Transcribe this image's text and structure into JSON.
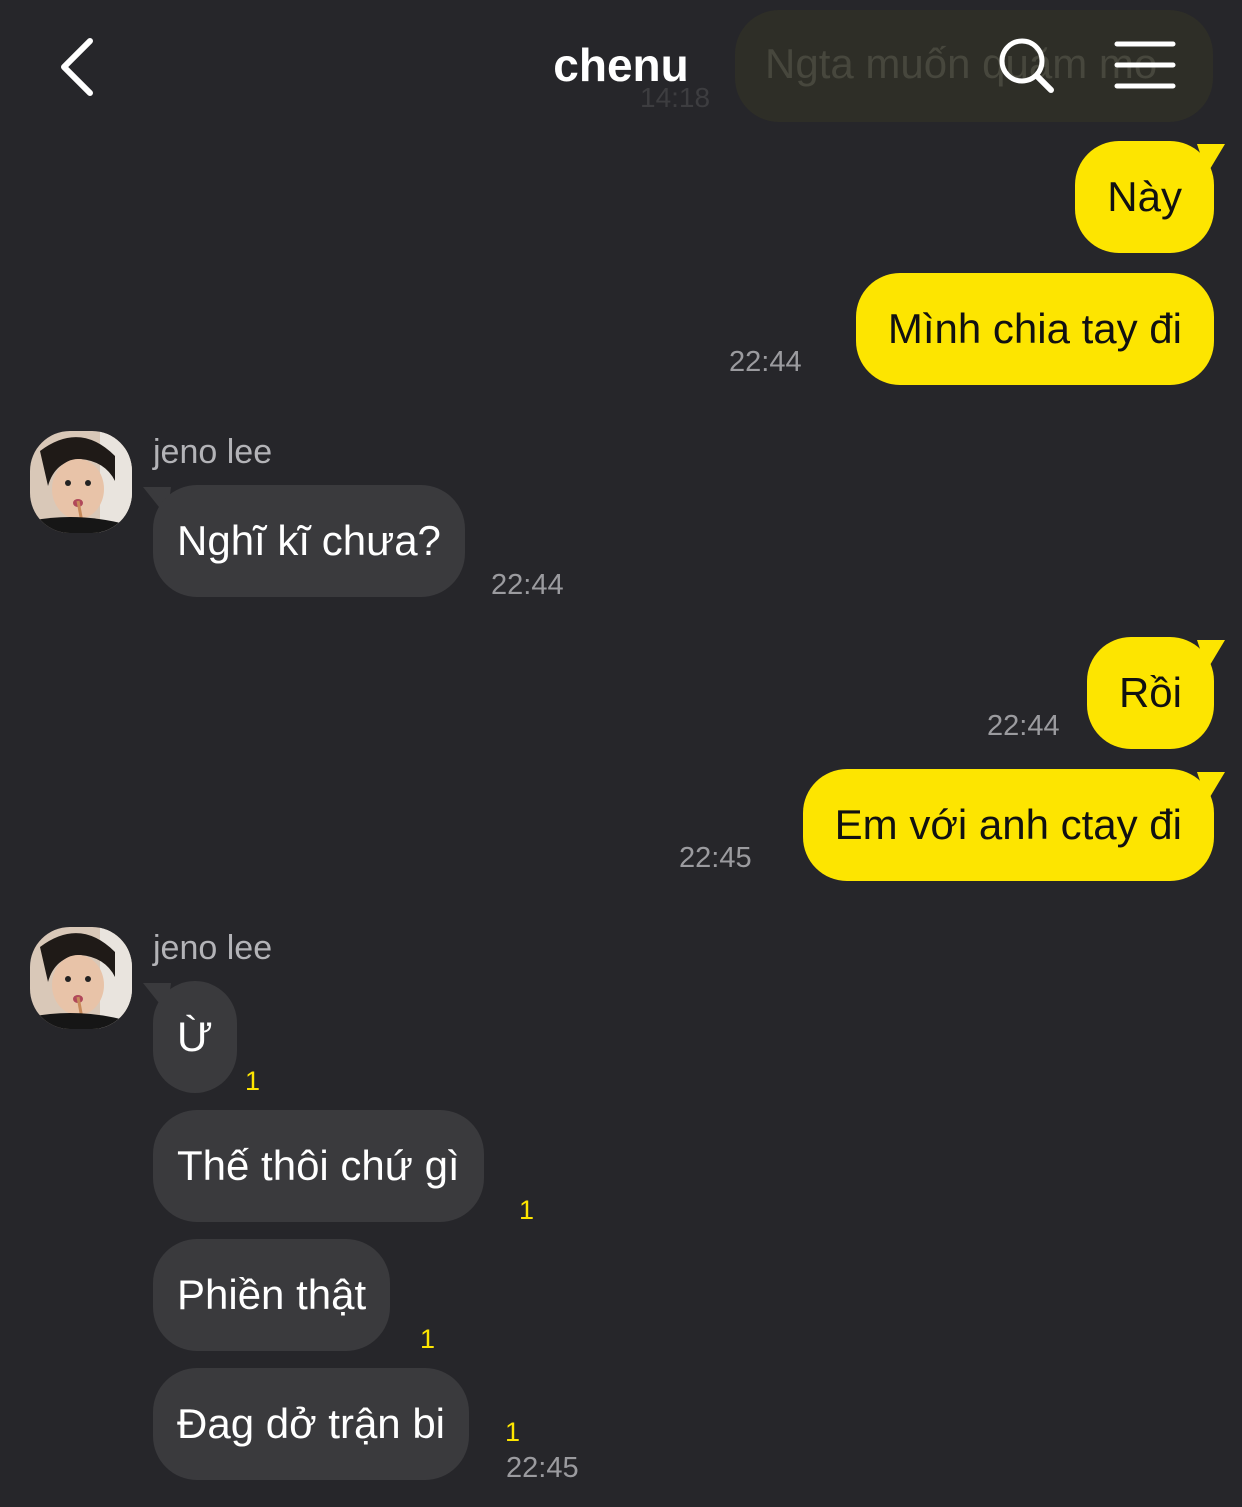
{
  "header": {
    "title": "chenu",
    "back_icon": "chevron-left-icon",
    "search_icon": "search-icon",
    "menu_icon": "menu-icon",
    "pinned_preview": {
      "text": "Ngta muốn quăm mo",
      "time": "14:18"
    }
  },
  "colors": {
    "background": "#26262a",
    "my_bubble": "#fde500",
    "their_bubble": "#3a3a3d",
    "unread": "#fde500"
  },
  "messages": {
    "m1": {
      "text": "Này"
    },
    "m2": {
      "text": "Mình chia tay đi",
      "time": "22:44"
    },
    "g1": {
      "sender": "jeno lee",
      "text": "Nghĩ kĩ chưa?",
      "time": "22:44"
    },
    "m3": {
      "text": "Rồi",
      "time": "22:44"
    },
    "m4": {
      "text": "Em với anh ctay đi",
      "time": "22:45"
    },
    "g2": {
      "sender": "jeno lee",
      "items": [
        {
          "text": "Ừ",
          "unread": "1"
        },
        {
          "text": "Thế thôi chứ gì",
          "unread": "1"
        },
        {
          "text": "Phiền thật",
          "unread": "1"
        },
        {
          "text": "Đag dở trận bi",
          "unread": "1",
          "time": "22:45"
        }
      ]
    }
  }
}
